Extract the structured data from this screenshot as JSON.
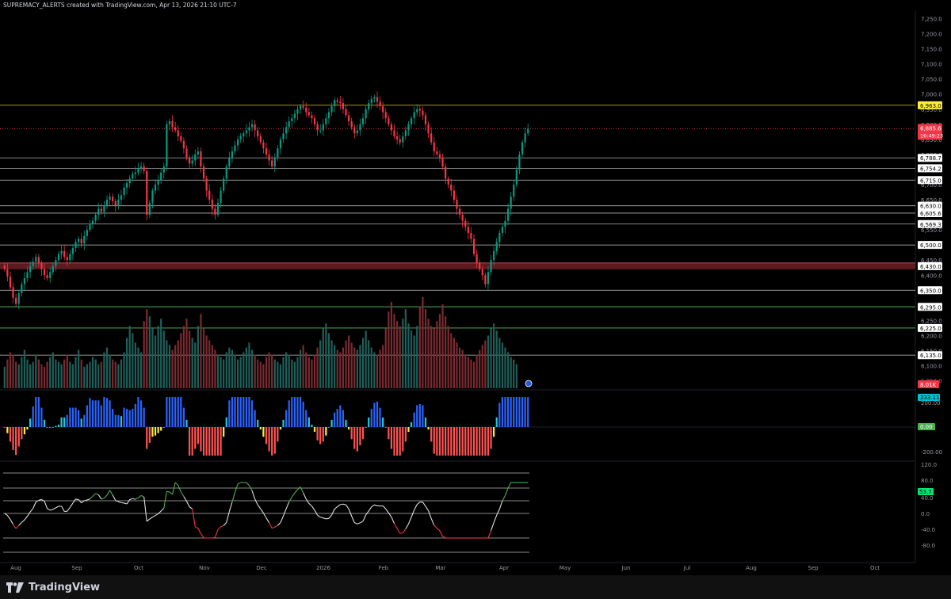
{
  "header": {
    "text": "SUPREMACY_ALERTS created with TradingView.com, Apr 13, 2026 21:10 UTC-7"
  },
  "brand": {
    "name": "TradingView"
  },
  "colors": {
    "bg": "#000000",
    "up": "#089981",
    "down": "#f23645",
    "grid": "#1e222d",
    "level": "#c8c8c8",
    "yellow": "#ffeb3b",
    "zone": "#5d1a1f",
    "green_level": "#4caf50",
    "axis_text": "#9598a1"
  },
  "chart_data": [
    {
      "type": "candlestick",
      "title": "",
      "price_axis_ticks": [
        "7,250.0",
        "7,200.0",
        "7,150.0",
        "7,100.0",
        "7,050.0",
        "7,000.0",
        "6,950.0",
        "6,900.0",
        "6,850.0",
        "6,800.0",
        "6,750.0",
        "6,700.0",
        "6,650.0",
        "6,600.0",
        "6,550.0",
        "6,500.0",
        "6,450.0",
        "6,400.0",
        "6,350.0",
        "6,300.0",
        "6,250.0",
        "6,200.0",
        "6,150.0",
        "6,100.0",
        "6,050.0"
      ],
      "ylim": [
        6020,
        7275
      ],
      "time_axis_ticks": [
        "Aug",
        "Sep",
        "Oct",
        "Nov",
        "Dec",
        "2026",
        "Feb",
        "Mar",
        "Apr",
        "May",
        "Jun",
        "Jul",
        "Aug",
        "Sep",
        "Oct"
      ],
      "levels": [
        {
          "label": "6,963.0",
          "value": 6963,
          "style": "yellow"
        },
        {
          "label": "6,788.7",
          "value": 6788.7,
          "style": "white"
        },
        {
          "label": "6,754.2",
          "value": 6754.2,
          "style": "white"
        },
        {
          "label": "6,715.0",
          "value": 6715,
          "style": "white"
        },
        {
          "label": "6,630.0",
          "value": 6630,
          "style": "white"
        },
        {
          "label": "6,605.6",
          "value": 6605.6,
          "style": "white"
        },
        {
          "label": "6,569.3",
          "value": 6569.3,
          "style": "white"
        },
        {
          "label": "6,500.0",
          "value": 6500,
          "style": "white"
        },
        {
          "label": "6,430.0",
          "value": 6430,
          "style": "zone"
        },
        {
          "label": "6,350.0",
          "value": 6350,
          "style": "white"
        },
        {
          "label": "6,295.0",
          "value": 6295,
          "style": "green"
        },
        {
          "label": "6,225.0",
          "value": 6225,
          "style": "green"
        },
        {
          "label": "6,135.0",
          "value": 6135,
          "style": "white"
        }
      ],
      "last_price": {
        "label": "6,885.6",
        "countdown": "16:49:23",
        "value": 6885.6
      },
      "candles_description_note": "",
      "closes": [
        6420,
        6395,
        6360,
        6325,
        6305,
        6340,
        6370,
        6390,
        6410,
        6430,
        6445,
        6460,
        6440,
        6420,
        6400,
        6390,
        6410,
        6430,
        6450,
        6470,
        6480,
        6460,
        6450,
        6470,
        6490,
        6510,
        6520,
        6505,
        6530,
        6550,
        6570,
        6580,
        6600,
        6620,
        6610,
        6630,
        6650,
        6660,
        6645,
        6630,
        6650,
        6665,
        6690,
        6705,
        6720,
        6735,
        6740,
        6755,
        6760,
        6745,
        6600,
        6640,
        6680,
        6700,
        6715,
        6740,
        6760,
        6900,
        6910,
        6890,
        6880,
        6860,
        6845,
        6820,
        6790,
        6770,
        6780,
        6800,
        6810,
        6760,
        6720,
        6680,
        6650,
        6620,
        6600,
        6640,
        6680,
        6720,
        6760,
        6790,
        6810,
        6830,
        6850,
        6860,
        6870,
        6880,
        6890,
        6900,
        6880,
        6860,
        6840,
        6820,
        6800,
        6780,
        6760,
        6790,
        6820,
        6850,
        6870,
        6890,
        6910,
        6920,
        6935,
        6950,
        6960,
        6955,
        6940,
        6930,
        6920,
        6900,
        6880,
        6880,
        6900,
        6920,
        6940,
        6960,
        6980,
        6975,
        6970,
        6950,
        6930,
        6910,
        6890,
        6870,
        6880,
        6900,
        6920,
        6950,
        6970,
        6985,
        6990,
        6975,
        6960,
        6940,
        6920,
        6900,
        6880,
        6860,
        6850,
        6840,
        6860,
        6880,
        6900,
        6920,
        6940,
        6950,
        6945,
        6930,
        6900,
        6870,
        6840,
        6810,
        6800,
        6790,
        6760,
        6720,
        6700,
        6680,
        6650,
        6620,
        6600,
        6580,
        6560,
        6540,
        6520,
        6470,
        6440,
        6420,
        6400,
        6370,
        6410,
        6450,
        6480,
        6510,
        6540,
        6560,
        6580,
        6620,
        6660,
        6700,
        6750,
        6800,
        6840,
        6870,
        6885.6
      ],
      "volume_axis_label": "8.01K",
      "volumes": [
        0.9,
        1.2,
        1.5,
        1.4,
        1.1,
        1.0,
        1.3,
        1.6,
        1.2,
        1.0,
        1.1,
        1.4,
        1.2,
        1.0,
        0.9,
        1.1,
        1.3,
        1.5,
        1.2,
        1.1,
        1.0,
        1.2,
        1.4,
        1.1,
        1.0,
        1.3,
        1.6,
        1.2,
        0.9,
        1.0,
        1.1,
        1.3,
        1.2,
        1.0,
        1.1,
        1.5,
        1.7,
        1.4,
        1.2,
        1.1,
        1.0,
        1.2,
        1.5,
        2.1,
        2.6,
        2.3,
        1.9,
        1.7,
        1.5,
        2.8,
        3.3,
        3.0,
        2.5,
        2.2,
        2.6,
        2.9,
        2.4,
        2.0,
        1.8,
        1.6,
        1.8,
        2.0,
        2.3,
        2.6,
        2.9,
        2.4,
        2.1,
        1.9,
        2.6,
        3.1,
        2.5,
        2.2,
        2.0,
        1.8,
        1.6,
        1.4,
        1.3,
        1.2,
        1.5,
        1.7,
        1.6,
        1.4,
        1.2,
        1.3,
        1.5,
        1.7,
        1.9,
        1.6,
        1.4,
        1.2,
        1.1,
        1.0,
        1.3,
        1.5,
        1.4,
        1.2,
        1.1,
        1.0,
        1.3,
        1.5,
        1.4,
        1.2,
        1.1,
        1.3,
        1.6,
        1.8,
        1.5,
        1.3,
        1.2,
        1.4,
        1.7,
        2.0,
        2.5,
        2.7,
        2.3,
        2.0,
        1.8,
        1.6,
        1.5,
        1.7,
        2.0,
        2.2,
        1.9,
        1.7,
        1.6,
        1.8,
        2.1,
        2.4,
        2.0,
        1.7,
        1.5,
        1.4,
        1.6,
        1.8,
        2.5,
        3.2,
        3.6,
        3.1,
        2.8,
        2.6,
        2.9,
        3.3,
        2.7,
        2.4,
        2.2,
        2.6,
        3.4,
        3.8,
        3.3,
        2.9,
        2.6,
        2.5,
        2.8,
        3.1,
        3.5,
        3.0,
        2.6,
        2.3,
        2.1,
        1.9,
        1.7,
        1.6,
        1.4,
        1.3,
        1.2,
        1.1,
        1.4,
        1.6,
        1.8,
        2.0,
        2.2,
        2.5,
        2.7,
        2.4,
        2.1,
        1.9,
        1.7,
        1.5,
        1.3,
        1.2,
        1.0
      ],
      "osc1_axis": {
        "upper": "200.00",
        "zero_badge": "0.00",
        "lower": "-200.00",
        "value_badge": "233.11"
      },
      "osc2_axis": {
        "ticks": [
          "120.0",
          "80.0",
          "40.0",
          "0.0",
          "-40.0",
          "-80.0"
        ],
        "value_badge": "53.7"
      }
    }
  ]
}
